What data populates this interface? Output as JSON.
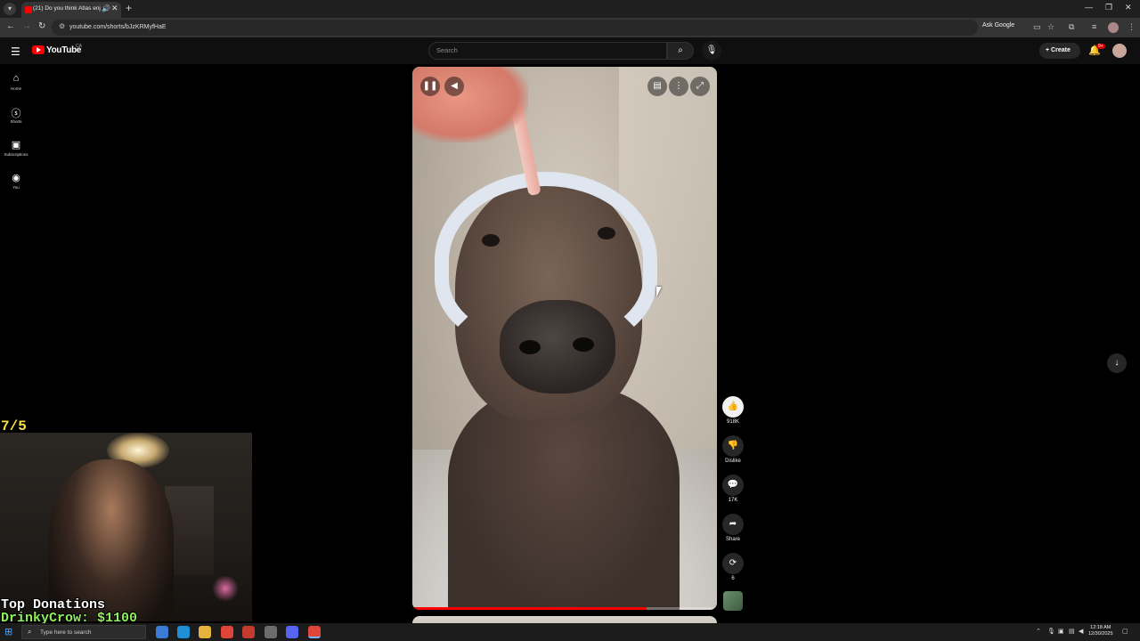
{
  "browser": {
    "tab_title": "(21) Do you think Atlas enj",
    "url": "youtube.com/shorts/bJzKRMyfHaE",
    "ask_google": "Ask Google",
    "window_controls": [
      "—",
      "❐",
      "✕"
    ]
  },
  "header": {
    "logo_text": "YouTube",
    "region": "CA",
    "search_placeholder": "Search",
    "create_label": "Create",
    "notification_badge": "9+"
  },
  "sidebar": {
    "items": [
      {
        "label": "Home",
        "icon": "home-icon"
      },
      {
        "label": "Shorts",
        "icon": "shorts-icon"
      },
      {
        "label": "Subscriptions",
        "icon": "subscriptions-icon"
      },
      {
        "label": "You",
        "icon": "you-icon"
      }
    ]
  },
  "player": {
    "progress_fraction": 0.77
  },
  "actions": {
    "like_count": "918K",
    "dislike_label": "Dislike",
    "comments_count": "17K",
    "share_label": "Share",
    "remix_count": "6"
  },
  "overlay": {
    "score": "7/5",
    "donations_title": "Top Donations",
    "donations_entry": "DrinkyCrow: $1100"
  },
  "taskbar": {
    "search_placeholder": "Type here to search",
    "time": "12:18 AM",
    "date": "12/30/2025"
  },
  "colors": {
    "yt_red": "#ff0000",
    "background": "#0f0f0f",
    "score_yellow": "#f5e046",
    "donation_green": "#8ef05a"
  }
}
